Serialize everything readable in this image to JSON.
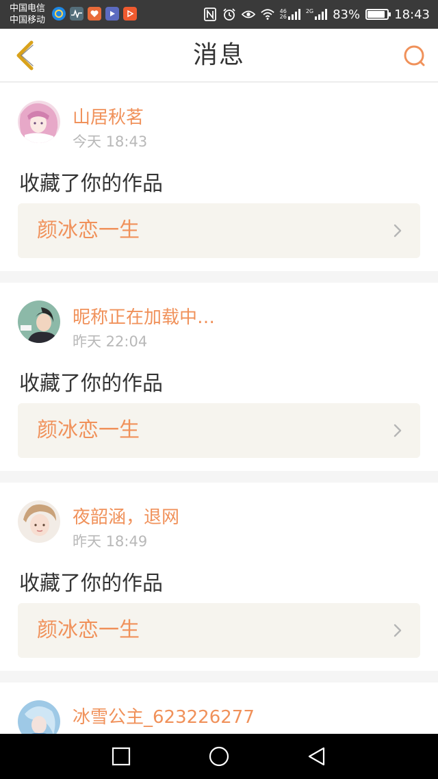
{
  "status_bar": {
    "carrier_1": "中国电信",
    "carrier_2": "中国移动",
    "net_top": "46",
    "net_bottom": "26",
    "net_2g": "2G",
    "battery_percent": "83%",
    "battery_level": 0.83,
    "time": "18:43"
  },
  "header": {
    "title": "消息"
  },
  "messages": [
    {
      "username": "山居秋茗",
      "time": "今天 18:43",
      "action": "收藏了你的作品",
      "work_title": "颜冰恋一生"
    },
    {
      "username": "昵称正在加载中…",
      "time": "昨天 22:04",
      "action": "收藏了你的作品",
      "work_title": "颜冰恋一生"
    },
    {
      "username": "夜韶涵，退网",
      "time": "昨天 18:49",
      "action": "收藏了你的作品",
      "work_title": "颜冰恋一生"
    },
    {
      "username": "冰雪公主_623226277"
    }
  ],
  "colors": {
    "accent": "#f0915a",
    "status_bar": "#3a3a3a",
    "card_link_bg": "#f6f4ee"
  }
}
